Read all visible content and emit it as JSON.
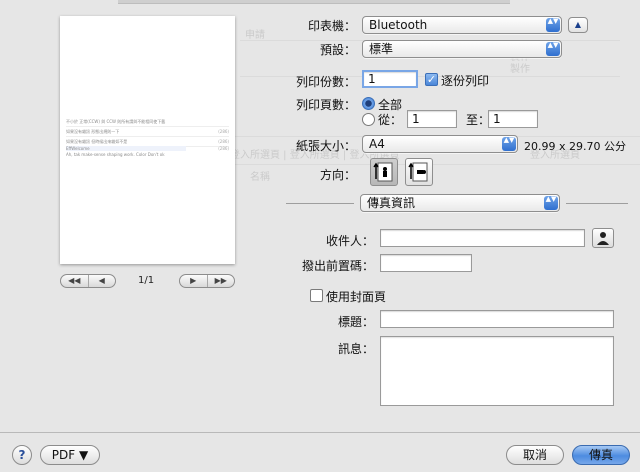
{
  "preview": {
    "paper_lines": [
      {
        "text": "不小於 正常(CCW) 與 CCW 則所有請與不能相同使下載",
        "num": ""
      },
      {
        "text": "如果沒有雜訊 形態出規則一下",
        "num": "(286)"
      },
      {
        "text": "如果沒有雜訊 但時候出來雜如不是",
        "num": "(286)"
      },
      {
        "text": "EffWelcome",
        "num": "(286)"
      },
      {
        "text": "Ah, tak make-sense shaping work. Color Don't ok",
        "num": ""
      }
    ],
    "page_indicator": "1/1",
    "nav_first": "◀◀",
    "nav_prev": "◀",
    "nav_next": "▶",
    "nav_last": "▶▶"
  },
  "ghost": {
    "texts": [
      "申請",
      "製作",
      "製作",
      "登入所選頁 | 登入所選頁 | 登入所選頁",
      "登入所選頁",
      "名稱"
    ]
  },
  "form": {
    "printer_label": "印表機：",
    "printer_value": "Bluetooth",
    "presets_label": "預設：",
    "presets_value": "標準",
    "copies_label": "列印份數：",
    "copies_value": "1",
    "collate_label": "逐份列印",
    "pages_label": "列印頁數：",
    "pages_all": "全部",
    "pages_from": "從：",
    "pages_from_value": "1",
    "pages_to": "至：",
    "pages_to_value": "1",
    "paper_size_label": "紙張大小：",
    "paper_size_value": "A4",
    "paper_size_dims": "20.99 x 29.70 公分",
    "orientation_label": "方向：",
    "section_value": "傳真資訊",
    "recipient_label": "收件人：",
    "recipient_value": "",
    "dial_prefix_label": "撥出前置碼：",
    "dial_prefix_value": "",
    "cover_page_label": "使用封面頁",
    "subject_label": "標題：",
    "subject_value": "",
    "message_label": "訊息：",
    "message_value": ""
  },
  "buttons": {
    "help": "?",
    "pdf": "PDF ▼",
    "cancel": "取消",
    "fax": "傳真"
  },
  "icons": {
    "disclosure": "▲",
    "popup_arrows": "▲▼"
  }
}
